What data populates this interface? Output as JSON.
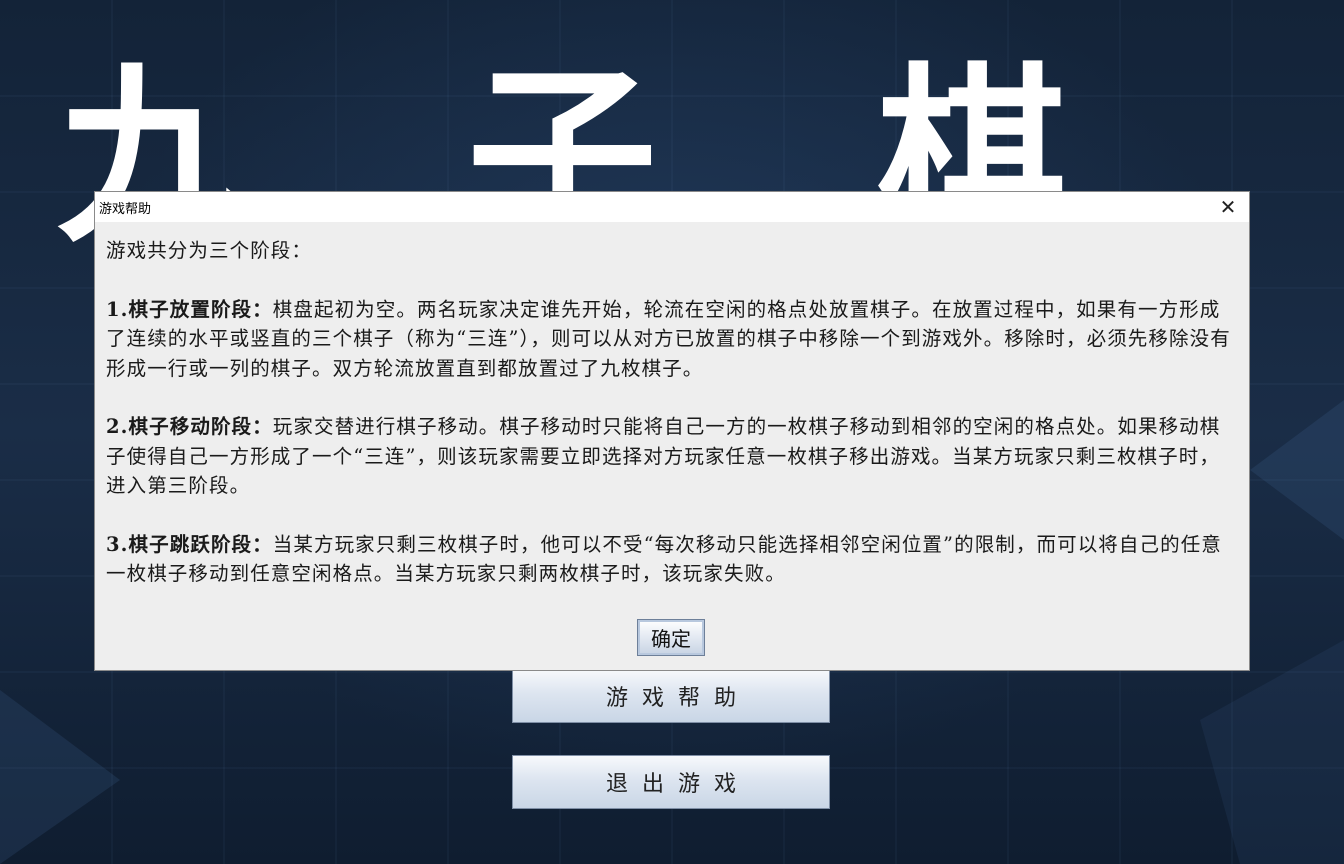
{
  "background": {
    "title": "九子棋",
    "menu": {
      "help_label": "游戏帮助",
      "exit_label": "退出游戏"
    }
  },
  "dialog": {
    "title": "游戏帮助",
    "close_icon": "close-icon",
    "intro": "游戏共分为三个阶段：",
    "stages": [
      {
        "heading": "1.棋子放置阶段：",
        "text": "棋盘起初为空。两名玩家决定谁先开始，轮流在空闲的格点处放置棋子。在放置过程中，如果有一方形成了连续的水平或竖直的三个棋子（称为“三连”），则可以从对方已放置的棋子中移除一个到游戏外。移除时，必须先移除没有形成一行或一列的棋子。双方轮流放置直到都放置过了九枚棋子。"
      },
      {
        "heading": "2.棋子移动阶段：",
        "text": "玩家交替进行棋子移动。棋子移动时只能将自己一方的一枚棋子移动到相邻的空闲的格点处。如果移动棋子使得自己一方形成了一个“三连”，则该玩家需要立即选择对方玩家任意一枚棋子移出游戏。当某方玩家只剩三枚棋子时，进入第三阶段。"
      },
      {
        "heading": "3.棋子跳跃阶段：",
        "text": "当某方玩家只剩三枚棋子时，他可以不受“每次移动只能选择相邻空闲位置”的限制，而可以将自己的任意一枚棋子移动到任意空闲格点。当某方玩家只剩两枚棋子时，该玩家失败。"
      }
    ],
    "ok_label": "确定"
  }
}
